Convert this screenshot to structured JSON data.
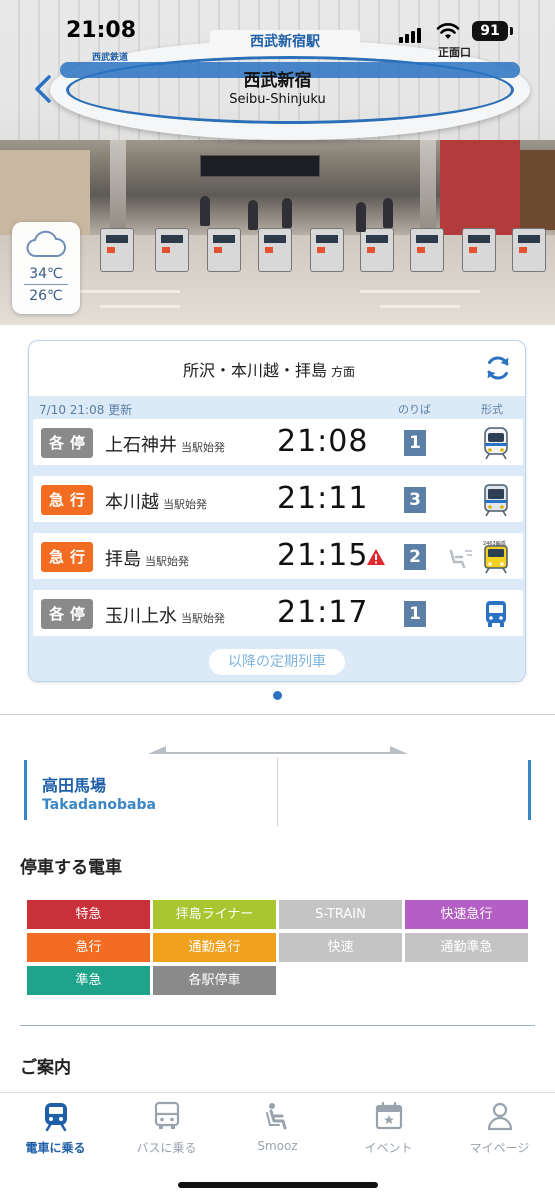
{
  "status_bar": {
    "time": "21:08",
    "battery": "91"
  },
  "station": {
    "name_ja": "西武新宿",
    "name_en": "Seibu-Shinjuku"
  },
  "photo": {
    "sign_top": "西武新宿駅",
    "logo": "西武鉄道",
    "exit_sign": "正面口"
  },
  "weather": {
    "icon": "cloud-icon",
    "high": "34℃",
    "low": "26℃"
  },
  "timetable": {
    "direction": "所沢・本川越・拝島",
    "direction_suffix": "方面",
    "updated": "7/10 21:08 更新",
    "col_track": "のりば",
    "col_type": "形式",
    "rows": [
      {
        "type": "各停",
        "type_color": "#8a8a8a",
        "destination": "上石神井",
        "origin": "当駅始発",
        "time": "21:08",
        "warning": false,
        "track": "1",
        "seat": false,
        "train_icon": "train-icon-white"
      },
      {
        "type": "急行",
        "type_color": "#f26d21",
        "destination": "本川越",
        "origin": "当駅始発",
        "time": "21:11",
        "warning": false,
        "track": "3",
        "seat": false,
        "train_icon": "train-icon-blue"
      },
      {
        "type": "急行",
        "type_color": "#f26d21",
        "destination": "拝島",
        "origin": "当駅始発",
        "time": "21:15",
        "warning": true,
        "track": "2",
        "seat": true,
        "train_icon": "train-icon-yellow"
      },
      {
        "type": "各停",
        "type_color": "#8a8a8a",
        "destination": "玉川上水",
        "origin": "当駅始発",
        "time": "21:17",
        "warning": false,
        "track": "1",
        "seat": false,
        "train_icon": "bus-icon"
      }
    ],
    "more_button": "以降の定期列車"
  },
  "route": {
    "next_station_ja": "高田馬場",
    "next_station_en": "Takadanobaba"
  },
  "train_types": {
    "title": "停車する電車",
    "items": [
      {
        "label": "特急",
        "color": "#c9303a"
      },
      {
        "label": "拝島ライナー",
        "color": "#a9c52f"
      },
      {
        "label": "S-TRAIN",
        "color": "#c4c4c4"
      },
      {
        "label": "快速急行",
        "color": "#b55ec6"
      },
      {
        "label": "急行",
        "color": "#f26d21"
      },
      {
        "label": "通勤急行",
        "color": "#f0a21e"
      },
      {
        "label": "快速",
        "color": "#c4c4c4"
      },
      {
        "label": "通勤準急",
        "color": "#c4c4c4"
      },
      {
        "label": "準急",
        "color": "#1fa38b"
      },
      {
        "label": "各駅停車",
        "color": "#8a8a8a"
      }
    ]
  },
  "guide": {
    "title": "ご案内"
  },
  "tabs": [
    {
      "label": "電車に乗る",
      "icon": "train-icon",
      "active": true
    },
    {
      "label": "バスに乗る",
      "icon": "bus-icon",
      "active": false
    },
    {
      "label": "Smooz",
      "icon": "seat-icon",
      "active": false
    },
    {
      "label": "イベント",
      "icon": "calendar-icon",
      "active": false
    },
    {
      "label": "マイページ",
      "icon": "person-icon",
      "active": false
    }
  ]
}
